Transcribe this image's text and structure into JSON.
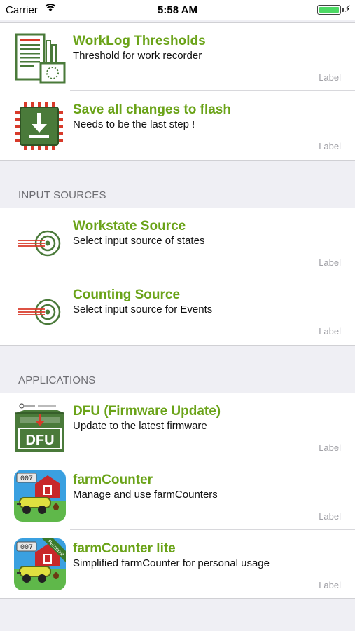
{
  "status_bar": {
    "carrier": "Carrier",
    "time": "5:58 AM"
  },
  "sections": [
    {
      "header": "",
      "items": [
        {
          "title": "WorkLog Thresholds",
          "subtitle": "Threshold for work recorder",
          "detail": "Label",
          "icon": "worklog-document-icon"
        },
        {
          "title": "Save all changes to flash",
          "subtitle": "Needs to be the last step !",
          "detail": "Label",
          "icon": "flash-chip-download-icon"
        }
      ]
    },
    {
      "header": "INPUT SOURCES",
      "items": [
        {
          "title": "Workstate Source",
          "subtitle": "Select input source of states",
          "detail": "Label",
          "icon": "target-arrow-icon"
        },
        {
          "title": "Counting Source",
          "subtitle": "Select input source for Events",
          "detail": "Label",
          "icon": "target-arrow-icon"
        }
      ]
    },
    {
      "header": "APPLICATIONS",
      "items": [
        {
          "title": "DFU (Firmware Update)",
          "subtitle": "Update to the latest firmware",
          "detail": "Label",
          "icon": "dfu-box-icon",
          "icon_text": "DFU"
        },
        {
          "title": "farmCounter",
          "subtitle": "Manage and use farmCounters",
          "detail": "Label",
          "icon": "farmcounter-app-icon",
          "icon_text": "007"
        },
        {
          "title": "farmCounter lite",
          "subtitle": "Simplified farmCounter for personal usage",
          "detail": "Label",
          "icon": "farmcounter-lite-app-icon",
          "icon_text": "007",
          "ribbon": "Personal"
        }
      ]
    }
  ],
  "colors": {
    "title_green": "#6aa318",
    "icon_green": "#4a7a3a",
    "chip_red": "#d83a2a",
    "detail_gray": "#a0a0a6",
    "background": "#efeff4"
  }
}
